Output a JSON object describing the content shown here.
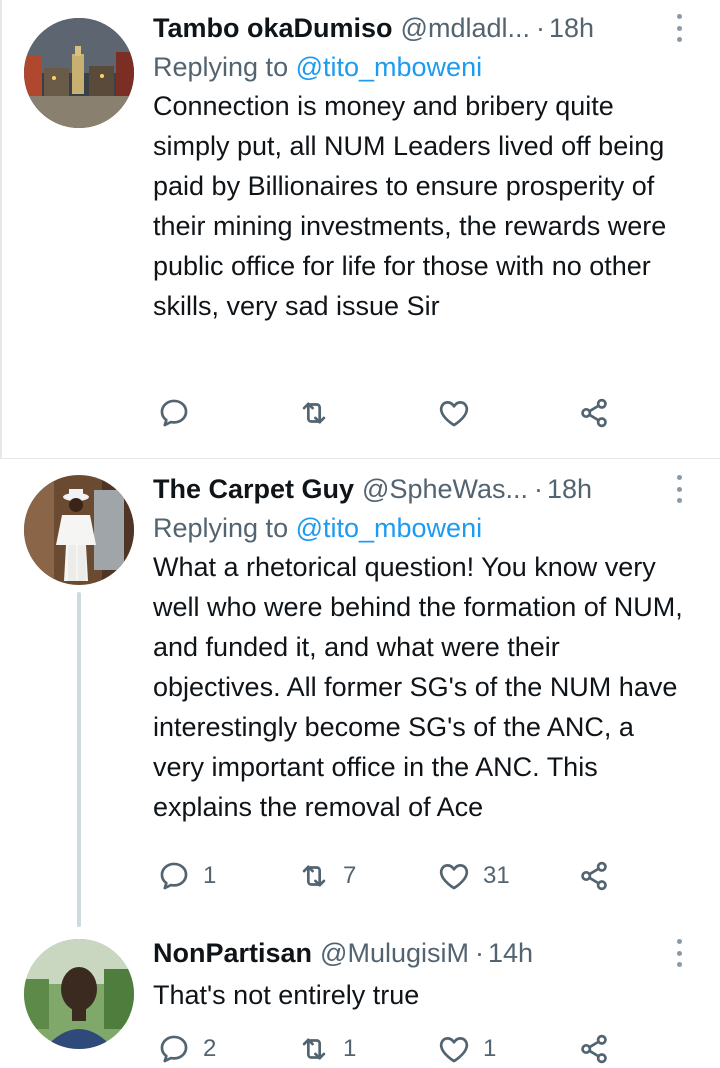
{
  "tweets": [
    {
      "name": "Tambo okaDumiso",
      "handle": "@mdladl...",
      "dot": "·",
      "time": "18h",
      "replying_prefix": "Replying to ",
      "replying_to": "@tito_mboweni",
      "text": "Connection is money and bribery quite simply put, all NUM Leaders lived off being paid by Billionaires to ensure prosperity of their mining investments, the rewards were public office for life for those with no other skills, very sad issue Sir",
      "reply_count": "",
      "retweet_count": "",
      "like_count": ""
    },
    {
      "name": "The Carpet Guy",
      "handle": "@SpheWas...",
      "dot": "·",
      "time": "18h",
      "replying_prefix": "Replying to ",
      "replying_to": "@tito_mboweni",
      "text": "What a rhetorical question! You know very well who were behind the formation of NUM, and funded it, and what were their objectives. All former SG's of the NUM have interestingly become SG's of the ANC, a very important office in the ANC. This explains the removal of Ace",
      "reply_count": "1",
      "retweet_count": "7",
      "like_count": "31"
    },
    {
      "name": "NonPartisan",
      "handle": "@MulugisiM",
      "dot": "·",
      "time": "14h",
      "text": "That's not entirely true",
      "reply_count": "2",
      "retweet_count": "1",
      "like_count": "1"
    }
  ],
  "icons": {
    "reply": "reply-icon",
    "retweet": "retweet-icon",
    "like": "heart-icon",
    "share": "share-icon",
    "more": "more-options-icon"
  },
  "colors": {
    "text": "#0f1419",
    "secondary": "#536471",
    "link": "#1d9bf0",
    "icon": "#536471",
    "thread_line": "#cfd9de"
  }
}
